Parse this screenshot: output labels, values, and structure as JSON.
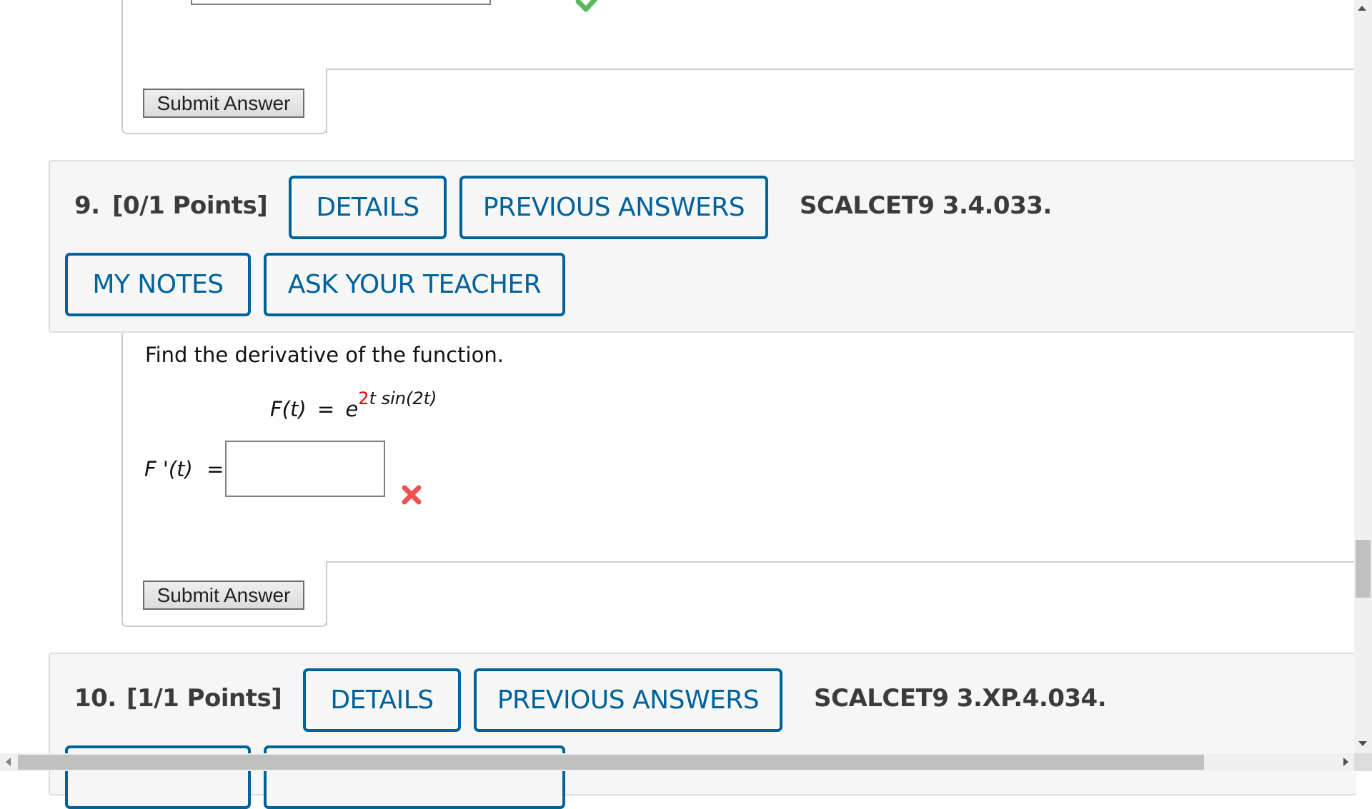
{
  "previous_question": {
    "answer_value": "",
    "status_icon": "check-icon",
    "submit_label": "Submit Answer"
  },
  "question9": {
    "number": "9.",
    "points": "[0/1 Points]",
    "details_label": "DETAILS",
    "previous_answers_label": "PREVIOUS ANSWERS",
    "code": "SCALCET9 3.4.033.",
    "my_notes_label": "MY NOTES",
    "ask_teacher_label": "ASK YOUR TEACHER",
    "prompt": "Find the derivative of the function.",
    "function_lhs": "F(t)",
    "equals": "=",
    "function_base": "e",
    "exponent_coef": "2",
    "exponent_rest": "t sin(2t)",
    "answer_label": "F '(t)",
    "answer_value": "",
    "status_icon": "x-icon",
    "submit_label": "Submit Answer"
  },
  "question10": {
    "number": "10.",
    "points": "[1/1 Points]",
    "details_label": "DETAILS",
    "previous_answers_label": "PREVIOUS ANSWERS",
    "code": "SCALCET9 3.XP.4.034."
  },
  "colors": {
    "accent": "#00629b",
    "correct": "#4caf50",
    "incorrect": "#e53935",
    "panel_bg": "#f6f6f6"
  }
}
